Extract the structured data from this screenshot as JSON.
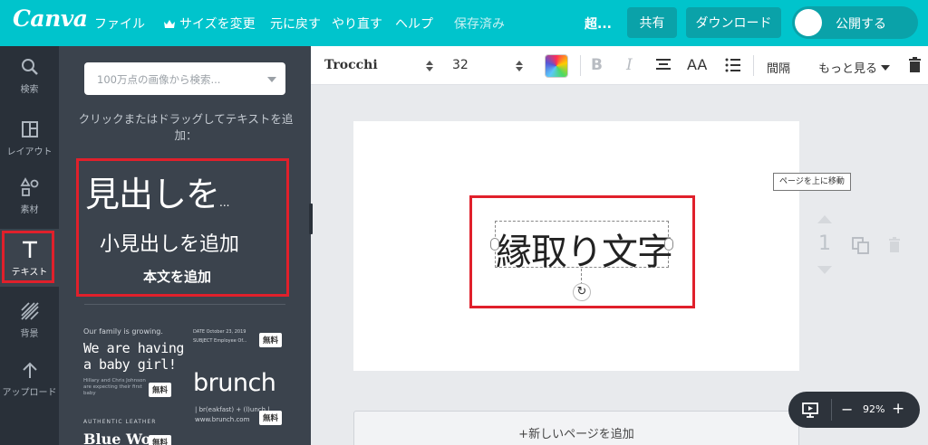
{
  "topbar": {
    "logo": "Canva",
    "menu": [
      "ファイル",
      "サイズを変更",
      "元に戻す",
      "やり直す",
      "ヘルプ"
    ],
    "status": "保存済み",
    "title": "超...",
    "share": "共有",
    "download": "ダウンロード",
    "publish": "公開する"
  },
  "leftnav": {
    "items": [
      {
        "label": "検索",
        "icon": "search-icon"
      },
      {
        "label": "レイアウト",
        "icon": "layout-icon"
      },
      {
        "label": "素材",
        "icon": "elements-icon"
      },
      {
        "label": "テキスト",
        "icon": "text-icon"
      },
      {
        "label": "背景",
        "icon": "background-icon"
      },
      {
        "label": "アップロード",
        "icon": "upload-icon"
      }
    ],
    "active": "テキスト"
  },
  "sidepanel": {
    "search_placeholder": "100万点の画像から検索...",
    "hint": "クリックまたはドラッグしてテキストを追加：",
    "heading": "見出しを",
    "heading_ellipsis": "...",
    "subheading": "小見出しを追加",
    "body": "本文を追加",
    "templates": {
      "t1_small": "Our family is growing.",
      "t1_main": [
        "We are having",
        "a baby girl!"
      ],
      "t1_fine": [
        "Hillary and Chris Johnson",
        "are expecting their first baby"
      ],
      "t2_meta": [
        "DATE    October 23, 2019",
        "SUBJECT  Employee Of..."
      ],
      "t2_main": "brunch",
      "t2_sub": [
        "| br(eakfast) + (l)unch |",
        "www.brunch.com"
      ],
      "t3_small": "AUTHENTIC LEATHER",
      "t3_main": "Blue Wo",
      "badge": "無料"
    }
  },
  "toolbar": {
    "font": "Trocchi",
    "size": "32",
    "bold": "B",
    "italic": "I",
    "case": "AA",
    "spacing": "間隔",
    "more": "もっと見る"
  },
  "canvas": {
    "text": "縁取り文字",
    "tooltip": "ページを上に移動",
    "page_number": "1",
    "add_page": "+新しいページを追加"
  },
  "zoom": {
    "minus": "−",
    "value": "92%",
    "plus": "+"
  },
  "colors": {
    "brand": "#00c4cc",
    "highlight": "#e0202b",
    "nav_bg": "#293039",
    "panel_bg": "#3b434d"
  }
}
